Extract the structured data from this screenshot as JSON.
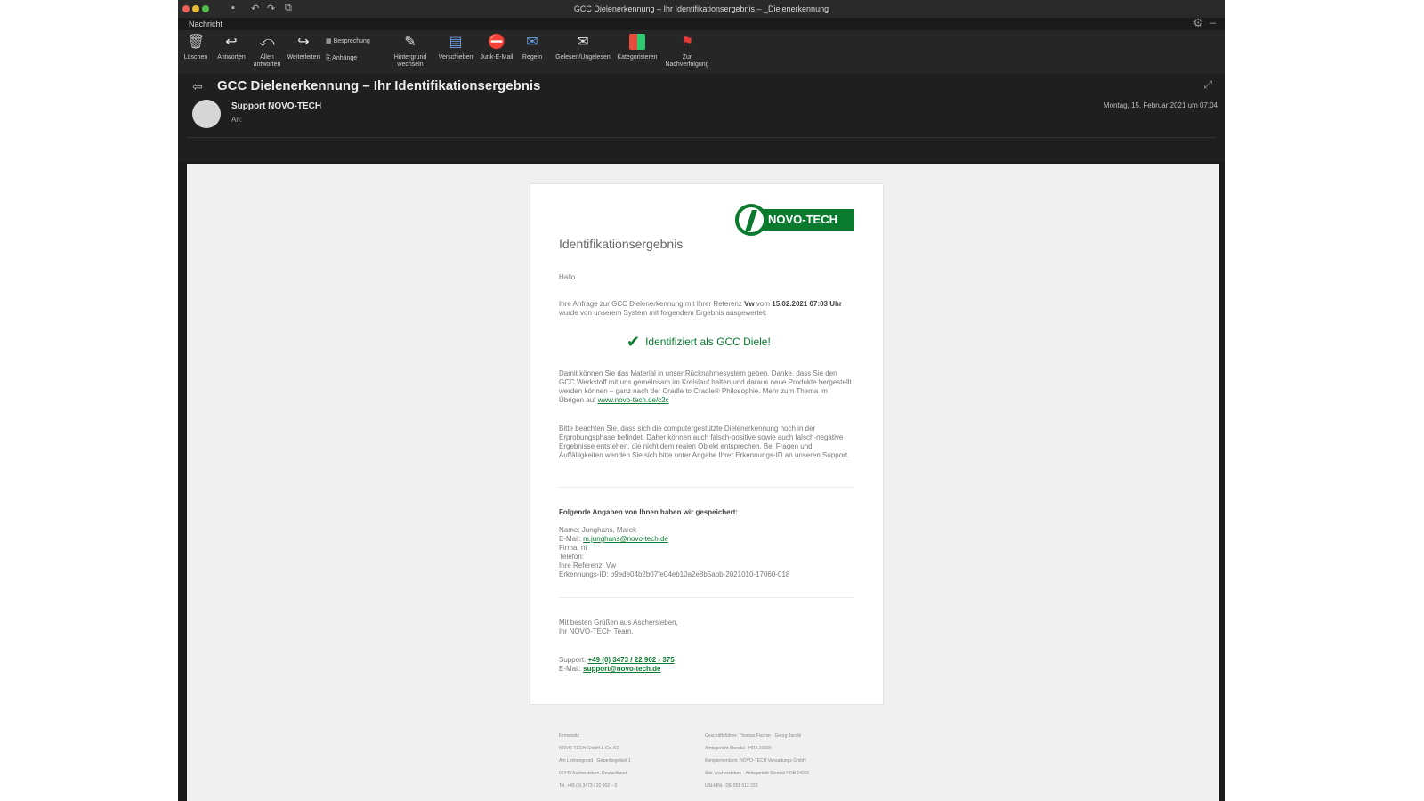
{
  "window": {
    "title": "GCC Dielenerkennung – Ihr Identifikationsergebnis – _Dielenerkennung",
    "tab": "Nachricht"
  },
  "ribbon": {
    "delete": "Löschen",
    "reply": "Antworten",
    "reply_all": "Allen antworten",
    "forward": "Weiterleiten",
    "meeting": "Besprechung",
    "attachment": "Anhänge",
    "move": "Verschieben",
    "junk": "Junk-E-Mail",
    "rules": "Regeln",
    "read_unread": "Gelesen/Ungelesen",
    "categorize": "Kategorisieren",
    "follow_up": "Zur Nachverfolgung",
    "background": "Hintergrund wechseln"
  },
  "message": {
    "subject": "GCC Dielenerkennung – Ihr Identifikationsergebnis",
    "sender": "Support NOVO-TECH",
    "to": "An:",
    "date": "Montag, 15. Februar 2021 um 07:04"
  },
  "email": {
    "logo_text": "NOVO-TECH",
    "title": "Identifikationsergebnis",
    "greeting": "Hallo",
    "intro_a": "Ihre Anfrage zur GCC Dielenerkennung mit Ihrer Referenz",
    "intro_ref": "Vw",
    "intro_b": "vom",
    "intro_date": "15.02.2021",
    "intro_time": "07:03 Uhr",
    "intro_c": "wurde von unserem System mit folgendem Ergebnis ausgewertet:",
    "result": "Identifiziert als GCC Diele!",
    "p2": "Damit können Sie das Material in unser Rücknahmesystem geben. Danke, dass Sie den GCC Werkstoff mit uns gemeinsam im Kreislauf halten und daraus neue Produkte hergestellt werden können – ganz nach der Cradle to Cradle® Philosophie. Mehr zum Thema im Übrigen auf",
    "p2_link": "www.novo-tech.de/c2c",
    "p3": "Bitte beachten Sie, dass sich die computergestützte Dielenerkennung noch in der Erprobungsphase befindet. Daher können auch falsch-positive sowie auch falsch-negative Ergebnisse entstehen, die nicht dem realen Objekt entsprechen. Bei Fragen und Auffälligkeiten wenden Sie sich bitte unter Angabe Ihrer Erkennungs-ID an unseren Support.",
    "data_heading": "Folgende Angaben von Ihnen haben wir gespeichert:",
    "name": "Name: Junghans, Marek",
    "email_label": "E-Mail:",
    "email_value": "m.junghans@novo-tech.de",
    "firma": "Firma: nt",
    "telefon": "Telefon:",
    "referenz": "Ihre Referenz: Vw",
    "erkennung": "Erkennungs-ID: b9ede04b2b07fe04eb10a2e8b5abb-2021010-17060-018",
    "closing1": "Mit besten Grüßen aus Aschersleben,",
    "closing2": "Ihr NOVO-TECH Team.",
    "support_label": "Support:",
    "support_phone": "+49 (0) 3473 / 22 902 - 375",
    "email2_label": "E-Mail:",
    "email2_value": "support@novo-tech.de"
  },
  "footer": {
    "left": [
      "Firmensitz",
      "NOVO-TECH GmbH & Co. KG",
      "Am Leimengrund · Gewerbegebiet 1",
      "06449 Aschersleben, Deutschland",
      "Tel. +49 (0) 3473 / 22 902 – 0"
    ],
    "right": [
      "Geschäftsführer: Thomas Fischer · Georg Jacobi",
      "Amtsgericht Stendal · HRA 21006",
      "Komplementärin: NOVO-TECH Verwaltungs GmbH",
      "Sitz: Aschersleben · Amtsgericht Stendal HRB 24001",
      "USt-IdNr.: DE 261 012 233"
    ]
  }
}
